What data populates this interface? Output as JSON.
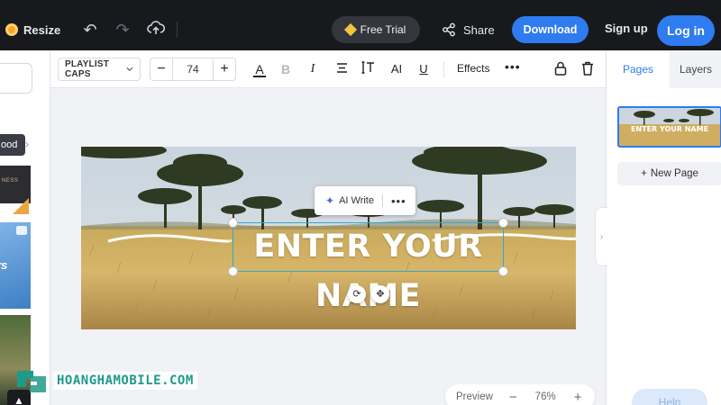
{
  "topbar": {
    "resize_label": "Resize",
    "free_trial_label": "Free Trial",
    "share_label": "Share",
    "download_label": "Download",
    "signup_label": "Sign up",
    "login_label": "Log in"
  },
  "left_panel": {
    "category_label": "ood",
    "strip_text": "NESS"
  },
  "toolbar": {
    "font_name": "PLAYLIST CAPS",
    "font_size": "74",
    "minus_symbol": "−",
    "plus_symbol": "+",
    "effects_label": "Effects",
    "more_symbol": "•••"
  },
  "canvas": {
    "headline": "ENTER YOUR NAME",
    "ai_write_label": "AI Write",
    "ai_more_symbol": "•••"
  },
  "zoom": {
    "preview_label": "Preview",
    "minus_symbol": "−",
    "zoom_value": "76%",
    "plus_symbol": "+"
  },
  "right_panel": {
    "tab_pages": "Pages",
    "tab_layers": "Layers",
    "new_page_label": "New Page",
    "help_label": "Help"
  },
  "watermark": {
    "text": "HOANGHAMOBILE.COM"
  },
  "colors": {
    "accent": "#2f7bf0",
    "topbar_bg": "#17191d",
    "selection": "#3aa6c9",
    "watermark": "#1e9a8a"
  }
}
